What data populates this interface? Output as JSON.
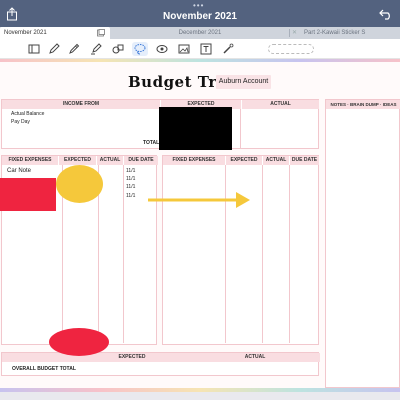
{
  "window": {
    "title": "November 2021",
    "dots": "•••"
  },
  "tabs": [
    {
      "label": "November 2021"
    },
    {
      "label": "December 2021"
    },
    {
      "label": "Part 2-Kawaii Sticker S"
    }
  ],
  "tracker": {
    "title": "Budget Tracker",
    "account": "Auburn Account"
  },
  "income": {
    "header_income": "INCOME FROM",
    "header_expected": "EXPECTED",
    "header_actual": "ACTUAL",
    "rows": [
      "Actual Balance",
      "Pay Day"
    ],
    "total_label": "TOTAL"
  },
  "notes": {
    "header": "NOTES · BRAIN DUMP · IDEAS"
  },
  "fixed_left": {
    "headers": [
      "FIXED EXPENSES",
      "EXPECTED",
      "ACTUAL",
      "DUE DATE"
    ],
    "rows": [
      {
        "name": "Car Note",
        "due": "11/1"
      },
      {
        "name": "",
        "due": "11/1"
      },
      {
        "name": "",
        "due": "11/1"
      },
      {
        "name": "",
        "due": "11/1"
      }
    ]
  },
  "fixed_right": {
    "headers": [
      "FIXED EXPENSES",
      "EXPECTED",
      "ACTUAL",
      "DUE DATE"
    ]
  },
  "overall": {
    "header_expected": "EXPECTED",
    "header_actual": "ACTUAL",
    "label": "OVERALL BUDGET TOTAL"
  },
  "colors": {
    "titlebar": "#53627f",
    "header_pink": "#f9dde1",
    "border_pink": "#f2c7cd",
    "yellow": "#f5c83b",
    "red": "#ef2440"
  },
  "icons": [
    "share-icon",
    "undo-icon",
    "thumbnails-icon",
    "bookmark-icon",
    "search-icon",
    "share-doc-icon",
    "reader-icon",
    "pen-icon",
    "highlighter-icon",
    "eraser-icon",
    "shapes-icon",
    "lasso-icon",
    "elements-icon",
    "image-icon",
    "camera-icon",
    "text-icon",
    "laser-icon"
  ]
}
